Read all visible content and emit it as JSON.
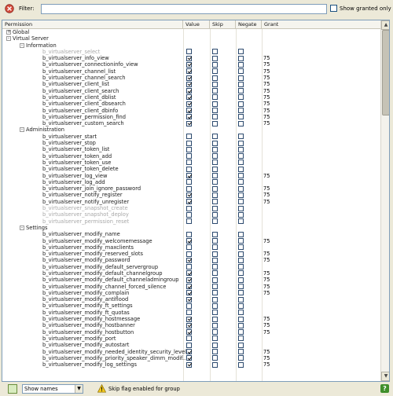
{
  "filter": {
    "label": "Filter:",
    "value": "",
    "show_granted_label": "Show granted only",
    "show_granted_checked": false
  },
  "columns": {
    "permission": "Permission",
    "value": "Value",
    "skip": "Skip",
    "negate": "Negate",
    "grant": "Grant"
  },
  "rows": [
    {
      "type": "group",
      "level": 0,
      "label": "Global",
      "toggle": "+"
    },
    {
      "type": "group",
      "level": 0,
      "label": "Virtual Server",
      "toggle": "-"
    },
    {
      "type": "group",
      "level": 1,
      "label": "Information",
      "toggle": "-"
    },
    {
      "type": "perm",
      "label": "b_virtualserver_select",
      "disabled": true,
      "value": false,
      "grant": ""
    },
    {
      "type": "perm",
      "label": "b_virtualserver_info_view",
      "value": true,
      "grant": "75"
    },
    {
      "type": "perm",
      "label": "b_virtualserver_connectioninfo_view",
      "value": true,
      "grant": "75"
    },
    {
      "type": "perm",
      "label": "b_virtualserver_channel_list",
      "value": true,
      "grant": "75"
    },
    {
      "type": "perm",
      "label": "b_virtualserver_channel_search",
      "value": true,
      "grant": "75"
    },
    {
      "type": "perm",
      "label": "b_virtualserver_client_list",
      "value": true,
      "grant": "75"
    },
    {
      "type": "perm",
      "label": "b_virtualserver_client_search",
      "value": true,
      "grant": "75"
    },
    {
      "type": "perm",
      "label": "b_virtualserver_client_dblist",
      "value": true,
      "grant": "75"
    },
    {
      "type": "perm",
      "label": "b_virtualserver_client_dbsearch",
      "value": true,
      "grant": "75"
    },
    {
      "type": "perm",
      "label": "b_virtualserver_client_dbinfo",
      "value": true,
      "grant": "75"
    },
    {
      "type": "perm",
      "label": "b_virtualserver_permission_find",
      "value": true,
      "grant": "75"
    },
    {
      "type": "perm",
      "label": "b_virtualserver_custom_search",
      "value": true,
      "grant": "75"
    },
    {
      "type": "group",
      "level": 1,
      "label": "Administration",
      "toggle": "-"
    },
    {
      "type": "perm",
      "label": "b_virtualserver_start",
      "value": false,
      "grant": ""
    },
    {
      "type": "perm",
      "label": "b_virtualserver_stop",
      "value": false,
      "grant": ""
    },
    {
      "type": "perm",
      "label": "b_virtualserver_token_list",
      "value": false,
      "grant": ""
    },
    {
      "type": "perm",
      "label": "b_virtualserver_token_add",
      "value": false,
      "grant": ""
    },
    {
      "type": "perm",
      "label": "b_virtualserver_token_use",
      "value": false,
      "grant": ""
    },
    {
      "type": "perm",
      "label": "b_virtualserver_token_delete",
      "value": false,
      "grant": ""
    },
    {
      "type": "perm",
      "label": "b_virtualserver_log_view",
      "value": true,
      "grant": "75"
    },
    {
      "type": "perm",
      "label": "b_virtualserver_log_add",
      "value": false,
      "grant": ""
    },
    {
      "type": "perm",
      "label": "b_virtualserver_join_ignore_password",
      "value": false,
      "grant": "75"
    },
    {
      "type": "perm",
      "label": "b_virtualserver_notify_register",
      "value": true,
      "grant": "75"
    },
    {
      "type": "perm",
      "label": "b_virtualserver_notify_unregister",
      "value": true,
      "grant": "75"
    },
    {
      "type": "perm",
      "label": "b_virtualserver_snapshot_create",
      "disabled": true,
      "value": false,
      "grant": ""
    },
    {
      "type": "perm",
      "label": "b_virtualserver_snapshot_deploy",
      "disabled": true,
      "value": false,
      "grant": ""
    },
    {
      "type": "perm",
      "label": "b_virtualserver_permission_reset",
      "disabled": true,
      "value": false,
      "grant": ""
    },
    {
      "type": "group",
      "level": 1,
      "label": "Settings",
      "toggle": "-"
    },
    {
      "type": "perm",
      "label": "b_virtualserver_modify_name",
      "value": false,
      "grant": ""
    },
    {
      "type": "perm",
      "label": "b_virtualserver_modify_welcomemessage",
      "value": true,
      "grant": "75"
    },
    {
      "type": "perm",
      "label": "b_virtualserver_modify_maxclients",
      "value": false,
      "grant": ""
    },
    {
      "type": "perm",
      "label": "b_virtualserver_modify_reserved_slots",
      "value": false,
      "grant": "75"
    },
    {
      "type": "perm",
      "label": "b_virtualserver_modify_password",
      "value": true,
      "grant": "75"
    },
    {
      "type": "perm",
      "label": "b_virtualserver_modify_default_servergroup",
      "value": false,
      "grant": ""
    },
    {
      "type": "perm",
      "label": "b_virtualserver_modify_default_channelgroup",
      "value": true,
      "grant": "75"
    },
    {
      "type": "perm",
      "label": "b_virtualserver_modify_default_channeladmingroup",
      "value": true,
      "grant": "75"
    },
    {
      "type": "perm",
      "label": "b_virtualserver_modify_channel_forced_silence",
      "value": true,
      "grant": "75"
    },
    {
      "type": "perm",
      "label": "b_virtualserver_modify_complain",
      "value": true,
      "grant": "75"
    },
    {
      "type": "perm",
      "label": "b_virtualserver_modify_antiflood",
      "value": true,
      "grant": ""
    },
    {
      "type": "perm",
      "label": "b_virtualserver_modify_ft_settings",
      "value": false,
      "grant": ""
    },
    {
      "type": "perm",
      "label": "b_virtualserver_modify_ft_quotas",
      "value": false,
      "grant": ""
    },
    {
      "type": "perm",
      "label": "b_virtualserver_modify_hostmessage",
      "value": true,
      "grant": "75"
    },
    {
      "type": "perm",
      "label": "b_virtualserver_modify_hostbanner",
      "value": true,
      "grant": "75"
    },
    {
      "type": "perm",
      "label": "b_virtualserver_modify_hostbutton",
      "value": true,
      "grant": "75"
    },
    {
      "type": "perm",
      "label": "b_virtualserver_modify_port",
      "value": false,
      "grant": ""
    },
    {
      "type": "perm",
      "label": "b_virtualserver_modify_autostart",
      "value": false,
      "grant": ""
    },
    {
      "type": "perm",
      "label": "b_virtualserver_modify_needed_identity_security_level",
      "value": true,
      "grant": "75"
    },
    {
      "type": "perm",
      "label": "b_virtualserver_modify_priority_speaker_dimm_modif...",
      "value": true,
      "grant": "75"
    },
    {
      "type": "perm",
      "label": "b_virtualserver_modify_log_settings",
      "value": true,
      "grant": "75"
    }
  ],
  "scrollbar": {
    "position_fraction": 0.0,
    "visible_fraction": 0.25
  },
  "bottom": {
    "names_mode": "Show names",
    "status": "Skip flag enabled for group",
    "help": "?"
  }
}
